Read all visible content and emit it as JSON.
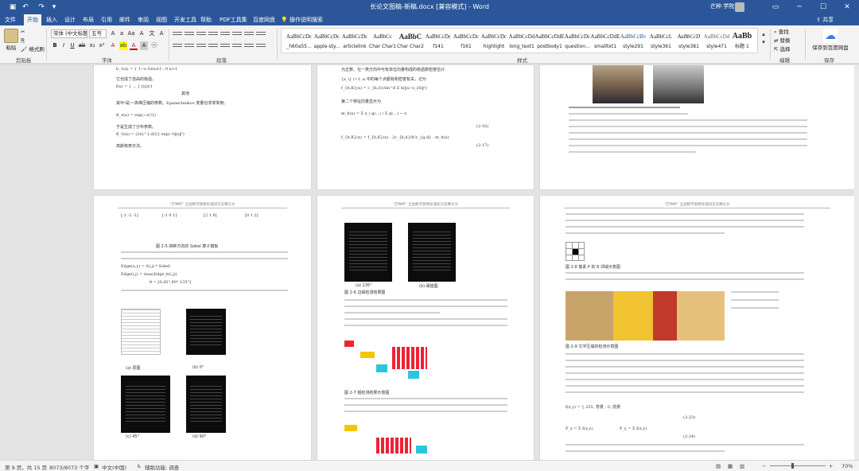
{
  "window": {
    "title": "长论文图稿-新稿.docx [兼容模式] - Word",
    "user": "芒种 学院",
    "quick_access": [
      "save-icon",
      "undo-icon",
      "redo-icon",
      "customize-icon"
    ]
  },
  "tabs": [
    "文件",
    "开始",
    "插入",
    "设计",
    "布局",
    "引用",
    "邮件",
    "审阅",
    "视图",
    "开发工具",
    "帮助",
    "PDF工具集",
    "百度网盘"
  ],
  "active_tab": "开始",
  "tellme": "操作说明搜索",
  "share": "共享",
  "ribbon": {
    "clipboard": {
      "paste": "粘贴",
      "cut": "剪切",
      "copy": "复制",
      "format_painter": "格式刷",
      "label": "剪贴板"
    },
    "font": {
      "name": "宋体 (中文标题)",
      "size": "五号",
      "label": "字体"
    },
    "paragraph": {
      "label": "段落"
    },
    "styles": {
      "label": "样式",
      "items": [
        {
          "preview": "AaBbCcDc",
          "name": "_h60a55..."
        },
        {
          "preview": "AaBbCcDc",
          "name": "apple-sty..."
        },
        {
          "preview": "AaBbCcDc",
          "name": "articlelink"
        },
        {
          "preview": "AaBbCc",
          "name": "Char Char1"
        },
        {
          "preview": "AaBbC",
          "name": "Char Char2"
        },
        {
          "preview": "AaBbCcDc",
          "name": "f141"
        },
        {
          "preview": "AaBbCcDc",
          "name": "f161"
        },
        {
          "preview": "AaBbCcDc",
          "name": "highlight"
        },
        {
          "preview": "AaBbCcDd",
          "name": "long_text1"
        },
        {
          "preview": "AaBbCcDdE",
          "name": "postbody1"
        },
        {
          "preview": "AaBbCcDc",
          "name": "question..."
        },
        {
          "preview": "AaBbCcDdE",
          "name": "smalltxt1"
        },
        {
          "preview": "AaBbCcBv",
          "name": "style291"
        },
        {
          "preview": "AaBbCcL",
          "name": "style361"
        },
        {
          "preview": "AaBbCcD",
          "name": "style381"
        },
        {
          "preview": "AaBbCcDd",
          "name": "style471"
        },
        {
          "preview": "AaBb",
          "name": "标题 1"
        }
      ]
    },
    "editing": {
      "find": "查找",
      "replace": "替换",
      "select": "选择",
      "label": "编辑"
    },
    "save": {
      "button": "保存到百度网盘",
      "label": "保存"
    }
  },
  "pages": {
    "header_text": "\"芒种杯\" 全国数字图像处理知识竞赛论文",
    "p1_eqs": [
      "b_1(x) = { 1−x  0≤x≤1 ; 0  x>1",
      "它也成了自由的核函。",
      "f(x) = { ... } [x]≤1",
      "其他",
      "其中ᵃ是ᵉ=高维压缩的参数。Epanechnikov 变量也非常常用。",
      "K_e(x) = exp(−x²/2)",
      "于是生成了分布参数。",
      "K_G(x) = (2π)^{-d/2} exp(-½‖x‖²)",
      "高斯核表示法。"
    ],
    "p2_eqs": [
      "为正数，在一类方向中可有单位向量构成的核函数密度估计",
      "{x_i} i=1..n 中的每个点都有和密度有关，记为",
      "f_{h,K}(x) = c_{k,d}/nh^d Σ k(‖x−x_i/h‖²)",
      "第二个特征向量显示为",
      "m_h(x) = Σ x_i g(...) / Σ g(...) − x",
      "(2-16)",
      "(2-17)",
      "f_{h,K}(x) = f_{h,K}(x) · 2c_{k,d}/h²c_{g,d} · m_h(x)"
    ],
    "p4_caption": "图 2-5 四种方向的 Sobel 算子模板",
    "p4_eqs": [
      "Edge(x,y) = f(i,j) * Sobel",
      "Edge(i,j) = max(Edge_k(i,j))",
      "θ = [0,45°,90°,135°]"
    ],
    "p4_subcaps": [
      "(a) 原图",
      "(b) 0°",
      "(c) 45°",
      "(d) 90°"
    ],
    "p5_caps": [
      "(a) 135°",
      "(b) 阈值图",
      "图 2-6 边缘检测效果图",
      "图 2-7 粗检测结果示意图"
    ],
    "p6_caps": [
      "图 2-8 像素 P 的 8 邻域示意图",
      "图 2-9 文字区域的检测示意图"
    ],
    "p6_eqs": [
      "f(x,y) = { 255, 背景 ; 0, 前景",
      "P_x = Σ f(x,y)",
      "P_y = Σ f(x,y)",
      "(2-23)",
      "(2-24)"
    ]
  },
  "status": {
    "page": "第 9 页，共 15 页",
    "words": "8073/8073 个字",
    "lang": "中文(中国)",
    "accessibility": "辅助功能: 调查",
    "zoom": "70%"
  }
}
